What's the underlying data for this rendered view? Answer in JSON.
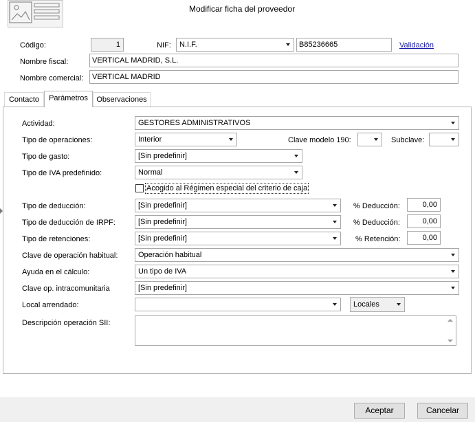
{
  "window": {
    "title": "Modificar ficha del proveedor"
  },
  "header": {
    "codigo_label": "Código:",
    "codigo_value": "1",
    "nif_label": "NIF:",
    "nif_type": "N.I.F.",
    "nif_value": "B85236665",
    "validacion_link": "Validación",
    "nombre_fiscal_label": "Nombre fiscal:",
    "nombre_fiscal_value": "VERTICAL MADRID, S.L.",
    "nombre_comercial_label": "Nombre comercial:",
    "nombre_comercial_value": "VERTICAL MADRID"
  },
  "tabs": [
    {
      "label": "Contacto"
    },
    {
      "label": "Parámetros"
    },
    {
      "label": "Observaciones"
    }
  ],
  "params": {
    "actividad_label": "Actividad:",
    "actividad_value": "GESTORES ADMINISTRATIVOS",
    "tipo_operaciones_label": "Tipo de operaciones:",
    "tipo_operaciones_value": "Interior",
    "clave190_label": "Clave modelo 190:",
    "clave190_value": "",
    "subclave_label": "Subclave:",
    "subclave_value": "",
    "tipo_gasto_label": "Tipo de gasto:",
    "tipo_gasto_value": "[Sin predefinir]",
    "tipo_iva_label": "Tipo de IVA predefinido:",
    "tipo_iva_value": "Normal",
    "acogido_label": "Acogido al Régimen especial del criterio de caja",
    "acogido_checked": false,
    "tipo_deduccion_label": "Tipo de deducción:",
    "tipo_deduccion_value": "[Sin predefinir]",
    "pct_deduccion_label": "% Deducción:",
    "pct_deduccion_value": "0,00",
    "tipo_deduccion_irpf_label": "Tipo de deducción de IRPF:",
    "tipo_deduccion_irpf_value": "[Sin predefinir]",
    "pct_deduccion_irpf_label": "% Deducción:",
    "pct_deduccion_irpf_value": "0,00",
    "tipo_retenciones_label": "Tipo de retenciones:",
    "tipo_retenciones_value": "[Sin predefinir]",
    "pct_retencion_label": "% Retención:",
    "pct_retencion_value": "0,00",
    "clave_operacion_label": "Clave de operación habitual:",
    "clave_operacion_value": "Operación habitual",
    "ayuda_calculo_label": "Ayuda en el cálculo:",
    "ayuda_calculo_value": "Un tipo de IVA",
    "clave_intracom_label": "Clave op. intracomunitaria",
    "clave_intracom_value": "[Sin predefinir]",
    "local_arrendado_label": "Local arrendado:",
    "local_arrendado_value": "",
    "locales_button": "Locales",
    "descripcion_sii_label": "Descripción operación SII:",
    "descripcion_sii_value": ""
  },
  "footer": {
    "accept_label": "Aceptar",
    "cancel_label": "Cancelar"
  },
  "colors": {
    "link": "#1a1aa6",
    "footer_bg": "#f0f0f0",
    "border": "#a7a7a7"
  }
}
